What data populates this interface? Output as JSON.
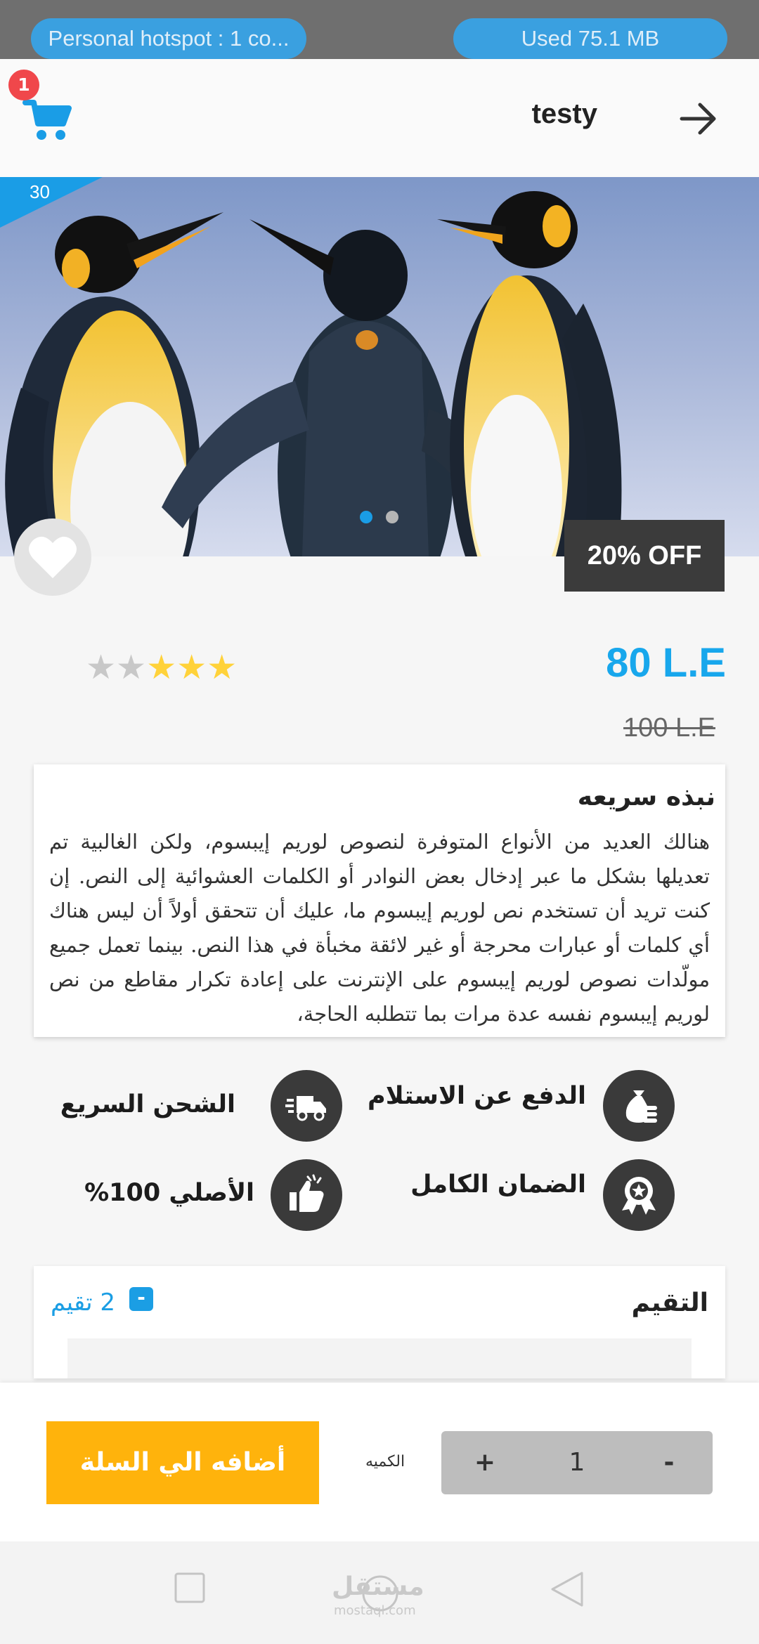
{
  "status": {
    "hotspot_text": "Personal hotspot : 1 co...",
    "used_text": "Used  75.1 MB"
  },
  "header": {
    "title": "testy",
    "cart_count": "1",
    "cart_icon": "cart-icon",
    "back_icon": "arrow-right-icon"
  },
  "product": {
    "corner_badge": "30",
    "discount_label": "20% OFF",
    "rating": 3,
    "max_rating": 5,
    "price": "80 L.E",
    "old_price": "100 L.E",
    "carousel_active_index": 0,
    "carousel_count": 2
  },
  "description": {
    "title": "نبذه سريعه",
    "text": "هنالك العديد من الأنواع المتوفرة لنصوص لوريم إيبسوم، ولكن الغالبية تم تعديلها بشكل ما عبر إدخال بعض النوادر أو الكلمات العشوائية إلى النص. إن كنت تريد أن تستخدم نص لوريم إيبسوم ما، عليك أن تتحقق أولاً أن ليس هناك أي كلمات أو عبارات محرجة أو غير لائقة مخبأة في هذا النص. بينما تعمل جميع مولّدات نصوص لوريم إيبسوم على الإنترنت على إعادة تكرار مقاطع من نص لوريم إيبسوم نفسه عدة مرات بما تتطلبه الحاجة،"
  },
  "features": {
    "cod": "الدفع عن الاستلام",
    "fast_shipping": "الشحن السريع",
    "warranty": "الضمان الكامل",
    "original": "الأصلي 100%"
  },
  "reviews": {
    "title": "التقيم",
    "count_label": "2 تقيم",
    "toggle_symbol": "-"
  },
  "cart_bar": {
    "add_button": "أضافه الي السلة",
    "quantity_label": "الكميه",
    "quantity": "1",
    "plus": "+",
    "minus": "-"
  },
  "watermark": {
    "logo_text": "مستقل",
    "domain": "mostaql.com"
  },
  "colors": {
    "accent": "#18a7ec",
    "add_button": "#ffb30c",
    "star_on": "#ffd23a",
    "star_off": "#c8c8c8",
    "badge": "#f0474b"
  }
}
